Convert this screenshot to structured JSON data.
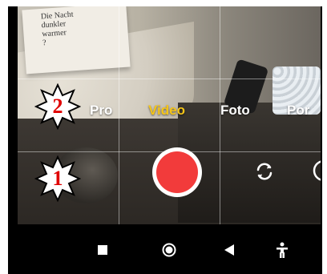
{
  "camera": {
    "modes": [
      {
        "label": "Pro"
      },
      {
        "label": "Video"
      },
      {
        "label": "Foto"
      },
      {
        "label": "Por"
      }
    ],
    "active_mode": "Video",
    "accent_color": "#f5c518",
    "record_color": "#f23b3b"
  },
  "scene": {
    "book_text": [
      "Die Nacht",
      "dunkler",
      "warmer",
      "?"
    ]
  },
  "annotations": [
    {
      "number": "1"
    },
    {
      "number": "2"
    }
  ],
  "controls": {
    "record_button": "record-icon",
    "switch_camera": "camera-switch-icon"
  },
  "navbar": {
    "items": [
      "recents-square-icon",
      "home-circle-icon",
      "back-triangle-icon",
      "accessibility-icon"
    ]
  }
}
